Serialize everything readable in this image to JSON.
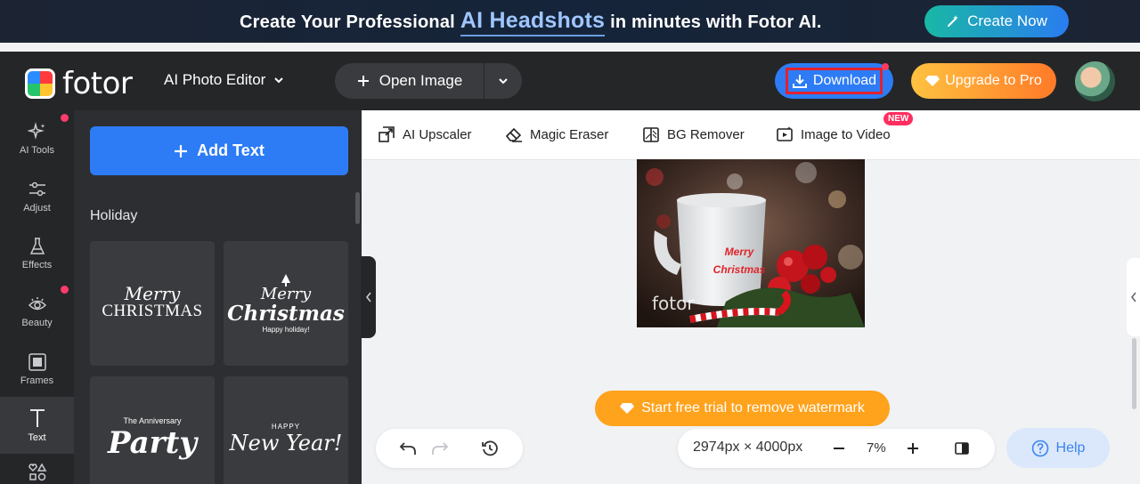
{
  "banner": {
    "text_before": "Create Your Professional",
    "highlight": "AI Headshots",
    "text_after": "in minutes with Fotor AI.",
    "cta": "Create Now"
  },
  "header": {
    "logo_text": "fotor",
    "editor_menu": "AI Photo Editor",
    "open_image": "Open Image",
    "download": "Download",
    "upgrade": "Upgrade to Pro"
  },
  "rail": {
    "items": [
      {
        "label": "AI Tools",
        "icon": "sparkle-icon"
      },
      {
        "label": "Adjust",
        "icon": "sliders-icon"
      },
      {
        "label": "Effects",
        "icon": "flask-icon"
      },
      {
        "label": "Beauty",
        "icon": "eye-icon"
      },
      {
        "label": "Frames",
        "icon": "frame-icon"
      },
      {
        "label": "Text",
        "icon": "text-icon"
      }
    ],
    "active": "Text"
  },
  "panel": {
    "add_text": "Add Text",
    "section": "Holiday",
    "templates": [
      {
        "line1": "Merry",
        "line2": "CHRISTMAS"
      },
      {
        "line1": "Merry",
        "line2": "Christmas",
        "line3": "Happy holiday!"
      },
      {
        "line1": "The Anniversary",
        "line2": "Party"
      },
      {
        "line1": "HAPPY",
        "line2": "New Year!"
      }
    ]
  },
  "tools": {
    "items": [
      "AI Upscaler",
      "Magic Eraser",
      "BG Remover",
      "Image to Video"
    ],
    "new_badge": "NEW"
  },
  "canvas": {
    "overlay_line1": "Merry",
    "overlay_line2": "Christmas",
    "watermark": "fotor"
  },
  "footer": {
    "trial": "Start free trial to remove watermark",
    "dimensions": "2974px × 4000px",
    "zoom": "7%",
    "help": "Help"
  },
  "colors": {
    "accent": "#2d7cf6",
    "dark_bg": "#252628",
    "panel_bg": "#2d2e31",
    "trial_orange": "#ffa21c",
    "download_outline": "#e3222f"
  }
}
